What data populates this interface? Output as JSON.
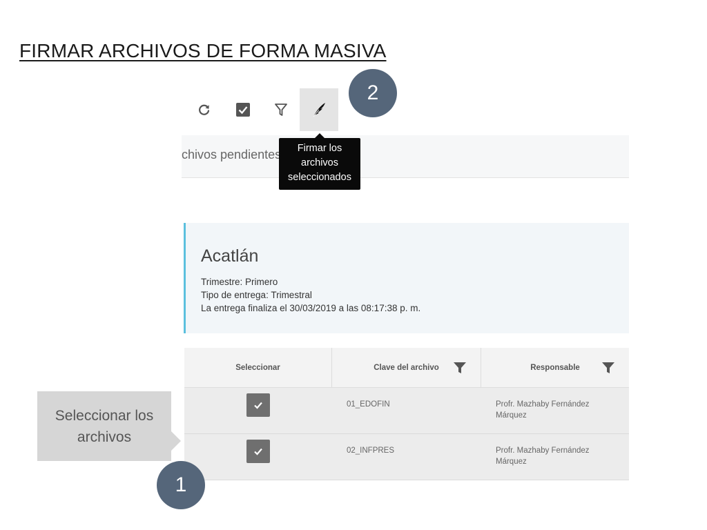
{
  "slide_title": "FIRMAR ARCHIVOS DE FORMA MASIVA",
  "toolbar": {
    "buttons": [
      {
        "icon": "refresh-icon"
      },
      {
        "icon": "checkbox-icon"
      },
      {
        "icon": "filter-icon"
      },
      {
        "icon": "feather-sign-icon",
        "active": true
      }
    ],
    "tooltip_lines": [
      "Firmar los",
      "archivos",
      "seleccionados"
    ]
  },
  "subheader_text": "chivos pendientes",
  "card": {
    "title": "Acatlán",
    "trimestre": "Trimestre: Primero",
    "tipo_entrega": "Tipo de entrega: Trimestral",
    "finaliza": "La entrega finaliza el 30/03/2019 a las 08:17:38 p. m."
  },
  "table": {
    "headers": [
      "Seleccionar",
      "Clave del archivo",
      "Responsable"
    ],
    "rows": [
      {
        "selected": true,
        "clave": "01_EDOFIN",
        "responsable_line1": "Profr. Mazhaby Fernández",
        "responsable_line2": "Márquez"
      },
      {
        "selected": true,
        "clave": "02_INFPRES",
        "responsable_line1": "Profr. Mazhaby Fernández",
        "responsable_line2": "Márquez"
      }
    ]
  },
  "annotations": {
    "step1": "1",
    "step2": "2",
    "callout_line1": "Seleccionar los",
    "callout_line2": "archivos"
  },
  "colors": {
    "badge": "#55667a",
    "card_border": "#5bc0de",
    "callout_bg": "#d6d6d6",
    "tooltip_bg": "#0a0a0a"
  }
}
